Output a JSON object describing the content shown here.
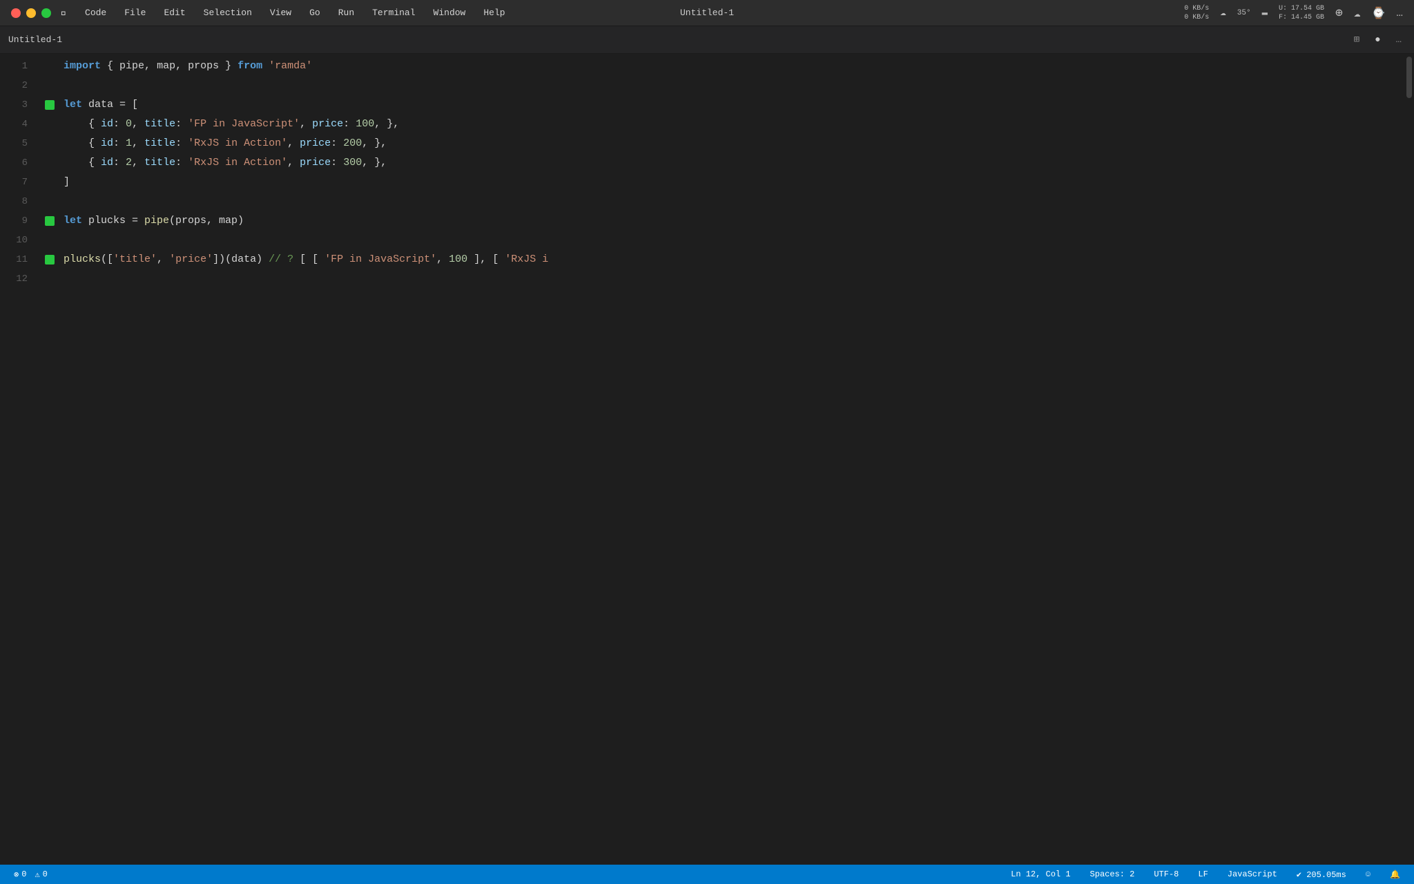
{
  "titlebar": {
    "title": "Untitled-1",
    "menu": {
      "apple": "⌘",
      "items": [
        "Code",
        "File",
        "Edit",
        "Selection",
        "View",
        "Go",
        "Run",
        "Terminal",
        "Window",
        "Help"
      ]
    },
    "right": {
      "network": "0 KB/s\n0 KB/s",
      "weather_icon": "☁",
      "temp": "35°",
      "battery_icon": "🔋",
      "storage": "U: 17.54 GB\nF: 14.45 GB",
      "icons": [
        "⊕",
        "☁",
        "⌚",
        "…"
      ]
    }
  },
  "tab": {
    "title": "Untitled-1",
    "split_icon": "⊞",
    "dot_icon": "●",
    "more_icon": "…"
  },
  "code": {
    "lines": [
      {
        "num": 1,
        "gutter": false,
        "tokens": [
          {
            "t": "import",
            "cls": "kw-import"
          },
          {
            "t": " { ",
            "cls": "plain"
          },
          {
            "t": "pipe",
            "cls": "plain"
          },
          {
            "t": ", ",
            "cls": "plain"
          },
          {
            "t": "map",
            "cls": "plain"
          },
          {
            "t": ", ",
            "cls": "plain"
          },
          {
            "t": "props",
            "cls": "plain"
          },
          {
            "t": " } ",
            "cls": "plain"
          },
          {
            "t": "from",
            "cls": "kw-from"
          },
          {
            "t": " ",
            "cls": "plain"
          },
          {
            "t": "'ramda'",
            "cls": "string"
          }
        ]
      },
      {
        "num": 2,
        "gutter": false,
        "tokens": []
      },
      {
        "num": 3,
        "gutter": true,
        "tokens": [
          {
            "t": "let",
            "cls": "kw-let"
          },
          {
            "t": " data = [",
            "cls": "plain"
          }
        ]
      },
      {
        "num": 4,
        "gutter": false,
        "tokens": [
          {
            "t": "    { ",
            "cls": "plain"
          },
          {
            "t": "id",
            "cls": "prop"
          },
          {
            "t": ": ",
            "cls": "plain"
          },
          {
            "t": "0",
            "cls": "number"
          },
          {
            "t": ", ",
            "cls": "plain"
          },
          {
            "t": "title",
            "cls": "prop"
          },
          {
            "t": ": ",
            "cls": "plain"
          },
          {
            "t": "'FP in JavaScript'",
            "cls": "string"
          },
          {
            "t": ", ",
            "cls": "plain"
          },
          {
            "t": "price",
            "cls": "prop"
          },
          {
            "t": ": ",
            "cls": "plain"
          },
          {
            "t": "100",
            "cls": "number"
          },
          {
            "t": ", },",
            "cls": "plain"
          }
        ]
      },
      {
        "num": 5,
        "gutter": false,
        "tokens": [
          {
            "t": "    { ",
            "cls": "plain"
          },
          {
            "t": "id",
            "cls": "prop"
          },
          {
            "t": ": ",
            "cls": "plain"
          },
          {
            "t": "1",
            "cls": "number"
          },
          {
            "t": ", ",
            "cls": "plain"
          },
          {
            "t": "title",
            "cls": "prop"
          },
          {
            "t": ": ",
            "cls": "plain"
          },
          {
            "t": "'RxJS in Action'",
            "cls": "string"
          },
          {
            "t": ", ",
            "cls": "plain"
          },
          {
            "t": "price",
            "cls": "prop"
          },
          {
            "t": ": ",
            "cls": "plain"
          },
          {
            "t": "200",
            "cls": "number"
          },
          {
            "t": ", },",
            "cls": "plain"
          }
        ]
      },
      {
        "num": 6,
        "gutter": false,
        "tokens": [
          {
            "t": "    { ",
            "cls": "plain"
          },
          {
            "t": "id",
            "cls": "prop"
          },
          {
            "t": ": ",
            "cls": "plain"
          },
          {
            "t": "2",
            "cls": "number"
          },
          {
            "t": ", ",
            "cls": "plain"
          },
          {
            "t": "title",
            "cls": "prop"
          },
          {
            "t": ": ",
            "cls": "plain"
          },
          {
            "t": "'RxJS in Action'",
            "cls": "string"
          },
          {
            "t": ", ",
            "cls": "plain"
          },
          {
            "t": "price",
            "cls": "prop"
          },
          {
            "t": ": ",
            "cls": "plain"
          },
          {
            "t": "300",
            "cls": "number"
          },
          {
            "t": ", },",
            "cls": "plain"
          }
        ]
      },
      {
        "num": 7,
        "gutter": false,
        "tokens": [
          {
            "t": "]",
            "cls": "plain"
          }
        ]
      },
      {
        "num": 8,
        "gutter": false,
        "tokens": []
      },
      {
        "num": 9,
        "gutter": true,
        "tokens": [
          {
            "t": "let",
            "cls": "kw-let"
          },
          {
            "t": " plucks = ",
            "cls": "plain"
          },
          {
            "t": "pipe",
            "cls": "fn-name"
          },
          {
            "t": "(props, map)",
            "cls": "plain"
          }
        ]
      },
      {
        "num": 10,
        "gutter": false,
        "tokens": []
      },
      {
        "num": 11,
        "gutter": true,
        "tokens": [
          {
            "t": "plucks",
            "cls": "fn-name"
          },
          {
            "t": "([",
            "cls": "plain"
          },
          {
            "t": "'title'",
            "cls": "string"
          },
          {
            "t": ", ",
            "cls": "plain"
          },
          {
            "t": "'price'",
            "cls": "string"
          },
          {
            "t": "])(data) ",
            "cls": "plain"
          },
          {
            "t": "// ? ",
            "cls": "comment"
          },
          {
            "t": "[ [ ",
            "cls": "plain"
          },
          {
            "t": "'FP in JavaScript'",
            "cls": "string"
          },
          {
            "t": ", ",
            "cls": "plain"
          },
          {
            "t": "100",
            "cls": "number"
          },
          {
            "t": " ], [ ",
            "cls": "plain"
          },
          {
            "t": "'RxJS i",
            "cls": "string"
          }
        ]
      },
      {
        "num": 12,
        "gutter": false,
        "tokens": []
      }
    ]
  },
  "statusbar": {
    "errors": "0",
    "warnings": "0",
    "position": "Ln 12, Col 1",
    "spaces": "Spaces: 2",
    "encoding": "UTF-8",
    "eol": "LF",
    "language": "JavaScript",
    "timing": "✔ 205.05ms",
    "bell_icon": "🔔",
    "feedback_icon": "☺"
  }
}
